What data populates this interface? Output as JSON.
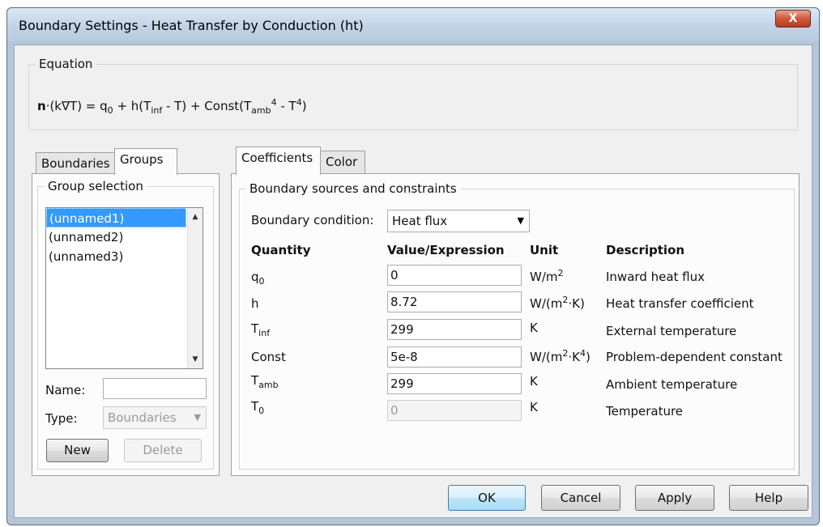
{
  "window": {
    "title": "Boundary Settings - Heat Transfer by Conduction (ht)",
    "close_label": "X"
  },
  "equation": {
    "legend": "Equation",
    "n": "n",
    "lhs": "·(k∇T) = q",
    "q_sub": "0",
    "mid1": " + h(T",
    "inf_sub": "inf",
    "mid2": " - T) + Const(T",
    "amb_sub": "amb",
    "pow4a": "4",
    "mid3": " - T",
    "pow4b": "4",
    "end": ")"
  },
  "left": {
    "tabs": [
      "Boundaries",
      "Groups"
    ],
    "active_tab": "Groups",
    "group_selection_legend": "Group selection",
    "groups": [
      "(unnamed1)",
      "(unnamed2)",
      "(unnamed3)"
    ],
    "selected_group": "(unnamed1)",
    "name_label": "Name:",
    "name_value": "",
    "type_label": "Type:",
    "type_value": "Boundaries",
    "new_label": "New",
    "delete_label": "Delete"
  },
  "right": {
    "tabs": [
      "Coefficients",
      "Color"
    ],
    "active_tab": "Coefficients",
    "section_legend": "Boundary sources and constraints",
    "bc_label": "Boundary condition:",
    "bc_value": "Heat flux",
    "headers": {
      "quantity": "Quantity",
      "value": "Value/Expression",
      "unit": "Unit",
      "description": "Description"
    },
    "rows": [
      {
        "q_base": "q",
        "q_sub": "0",
        "value": "0",
        "unit_base": "W/m",
        "unit_sup": "2",
        "unit_tail": "",
        "description": "Inward heat flux",
        "enabled": true
      },
      {
        "q_base": "h",
        "q_sub": "",
        "value": "8.72",
        "unit_base": "W/(m",
        "unit_sup": "2",
        "unit_tail": "·K)",
        "description": "Heat transfer coefficient",
        "enabled": true
      },
      {
        "q_base": "T",
        "q_sub": "inf",
        "value": "299",
        "unit_base": "K",
        "unit_sup": "",
        "unit_tail": "",
        "description": "External temperature",
        "enabled": true
      },
      {
        "q_base": "Const",
        "q_sub": "",
        "value": "5e-8",
        "unit_base": "W/(m",
        "unit_sup": "2",
        "unit_tail": "·K",
        "unit_sup2": "4",
        "unit_tail2": ")",
        "description": "Problem-dependent constant",
        "enabled": true
      },
      {
        "q_base": "T",
        "q_sub": "amb",
        "value": "299",
        "unit_base": "K",
        "unit_sup": "",
        "unit_tail": "",
        "description": "Ambient temperature",
        "enabled": true
      },
      {
        "q_base": "T",
        "q_sub": "0",
        "value": "0",
        "unit_base": "K",
        "unit_sup": "",
        "unit_tail": "",
        "description": "Temperature",
        "enabled": false
      }
    ]
  },
  "footer": {
    "ok": "OK",
    "cancel": "Cancel",
    "apply": "Apply",
    "help": "Help"
  }
}
